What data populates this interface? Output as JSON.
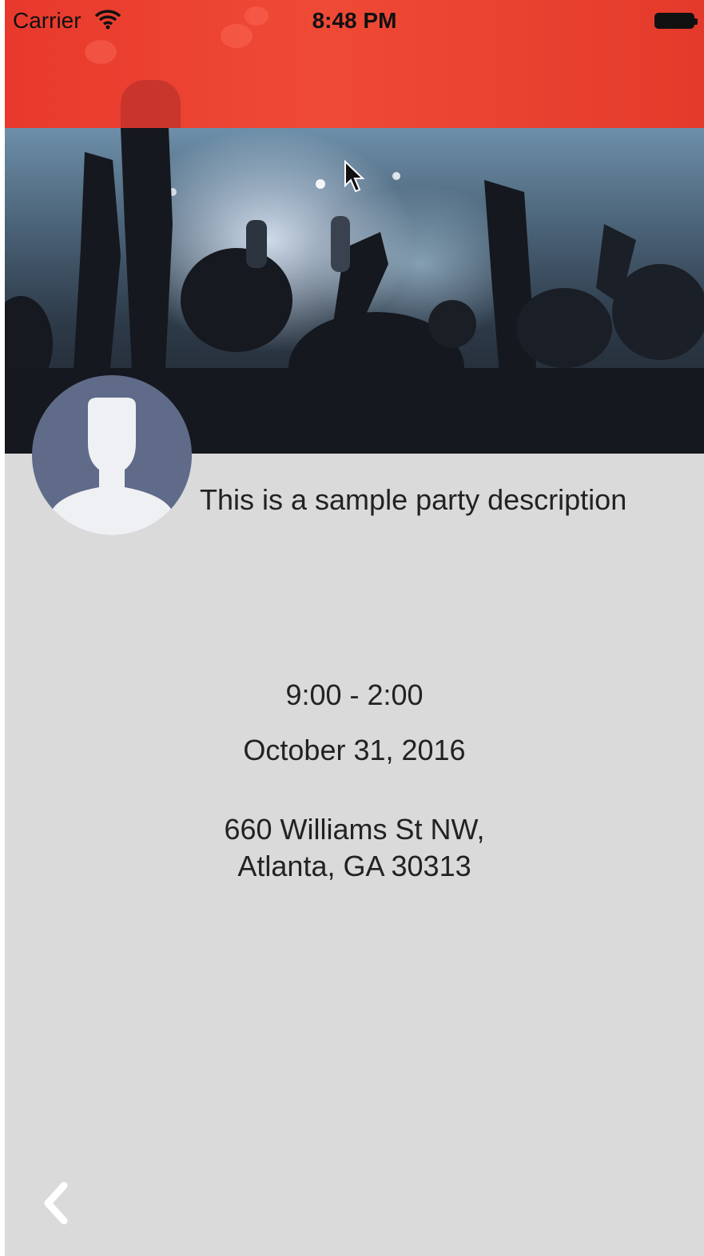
{
  "status_bar": {
    "carrier": "Carrier",
    "time": "8:48 PM"
  },
  "event": {
    "description": "This is a sample party description",
    "time_range": "9:00 - 2:00",
    "date": "October 31, 2016",
    "address_line1": "660 Williams St NW,",
    "address_line2": "Atlanta, GA 30313"
  },
  "icons": {
    "wifi": "wifi-icon",
    "battery": "battery-icon",
    "back": "chevron-left-icon",
    "avatar": "person-silhouette-icon",
    "cursor": "mouse-pointer-icon"
  },
  "colors": {
    "header_red": "#e8392c",
    "background_gray": "#dadada",
    "avatar_blue": "#5f6b89",
    "avatar_silhouette": "#eef0f3"
  }
}
